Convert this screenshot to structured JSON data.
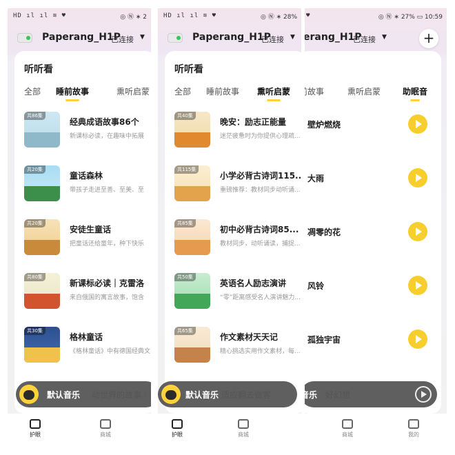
{
  "status": {
    "left": "HD ıl ıl ≋ ♥",
    "right_p1": "◎ Ⓝ ∗ 2",
    "right_p2": "◎ Ⓝ ∗ 28%",
    "right_p3": "◎ Ⓝ ∗ 27% ▭ 10:59"
  },
  "device": {
    "name": "Paperang_H1P",
    "name_partial": "erang_H1P",
    "status": "已连接"
  },
  "section_title": "听听看",
  "tabs": {
    "all": "全部",
    "bedtime": "睡前故事",
    "enlight": "熏听启蒙",
    "sleep": "助眠音",
    "bedtime_partial": "前故事"
  },
  "bedtime_list": [
    {
      "badge": "共86集",
      "title": "经典成语故事86个",
      "subtitle": "新课标必读，在趣味中拓展"
    },
    {
      "badge": "共20集",
      "title": "童话森林",
      "subtitle": "带孩子走进至善、至美、至"
    },
    {
      "badge": "共20集",
      "title": "安徒生童话",
      "subtitle": "把童话还给童年，种下快乐"
    },
    {
      "badge": "共80集",
      "title": "新课标必读｜克雷洛",
      "subtitle": "来自俄国的寓言故事，饱含"
    },
    {
      "badge": "共30集",
      "title": "格林童话",
      "subtitle": "《格林童话》中有德国经典文"
    }
  ],
  "enlight_list": [
    {
      "badge": "共40集",
      "title": "晚安：励志正能量",
      "subtitle": "迷茫疲惫时为你提供心理疏..."
    },
    {
      "badge": "共115集",
      "title": "小学必背古诗词115...",
      "subtitle": "重磅推荐：教材同步动听诵..."
    },
    {
      "badge": "共85集",
      "title": "初中必背古诗词85...",
      "subtitle": "教材同步，动听诵读，捕捉..."
    },
    {
      "badge": "共50集",
      "title": "英语名人励志演讲",
      "subtitle": "“零”距离感受名人演讲魅力..."
    },
    {
      "badge": "共65集",
      "title": "作文素材天天记",
      "subtitle": "精心挑选实用作文素材，每..."
    }
  ],
  "sleep_list": [
    {
      "title": "壁炉燃烧"
    },
    {
      "title": "大雨"
    },
    {
      "title": "凋零的花"
    },
    {
      "title": "风铃"
    },
    {
      "title": "孤独宇宙"
    }
  ],
  "player": {
    "label": "默认音乐",
    "label_partial": "音乐",
    "under_p1": "动世界的故事｜西",
    "under_p2": "适应翻去做客",
    "under_p3": "好幻想"
  },
  "nav": {
    "eye": "护眼",
    "shop": "商城",
    "me": "我的"
  },
  "colors": {
    "accent": "#f6cf2e",
    "tab_underline": "#ffd13a",
    "player_bg": "#3c3c3c"
  }
}
